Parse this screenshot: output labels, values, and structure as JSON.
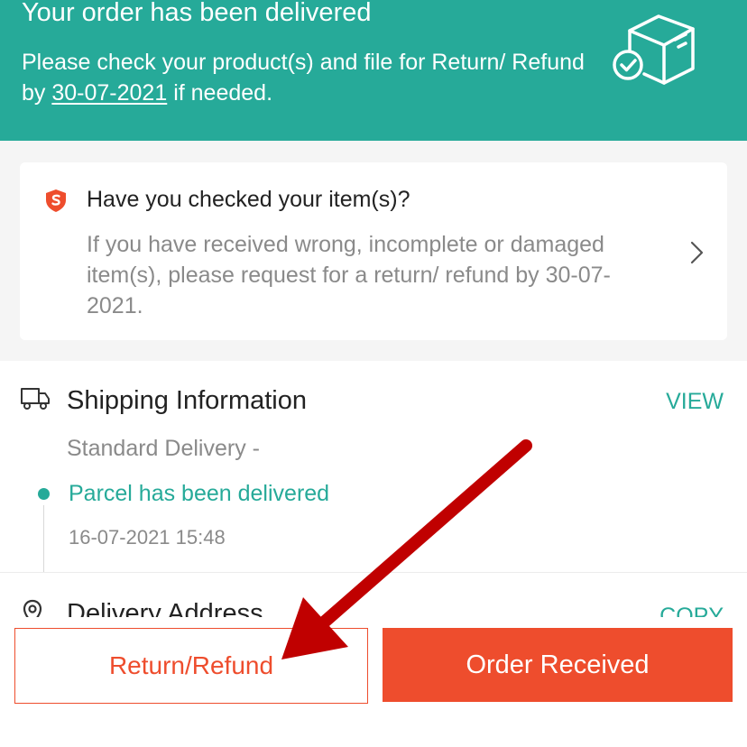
{
  "banner": {
    "title": "Your order has been delivered",
    "text_before": "Please check your product(s) and file for Return/ Refund by ",
    "date": "30-07-2021",
    "text_after": " if needed."
  },
  "check_card": {
    "title": "Have you checked your item(s)?",
    "text": "If you have received wrong, incomplete or damaged item(s), please request for a return/ refund by 30-07-2021."
  },
  "shipping": {
    "title": "Shipping Information",
    "view_label": "VIEW",
    "method": "Standard Delivery -",
    "status": "Parcel has been delivered",
    "timestamp": "16-07-2021 15:48"
  },
  "address": {
    "title": "Delivery Address",
    "copy_label": "COPY"
  },
  "actions": {
    "return_label": "Return/Refund",
    "received_label": "Order Received"
  },
  "colors": {
    "brand_green": "#26aa99",
    "brand_orange": "#ee4d2d",
    "annotation_arrow": "#c00000"
  },
  "icons": [
    "box-check-icon",
    "shield-icon",
    "chevron-right-icon",
    "truck-icon",
    "location-pin-icon",
    "annotation-arrow"
  ]
}
